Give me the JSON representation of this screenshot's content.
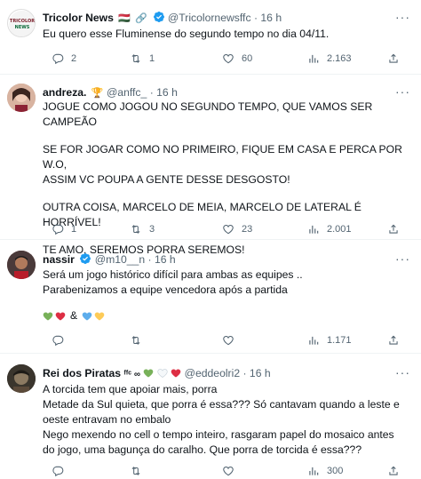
{
  "tweets": [
    {
      "name": "Tricolor News",
      "flag": "🇭🇺",
      "extra_icon": "🔗",
      "handle": "@Tricolornewsffc",
      "time": "· 16 h",
      "avatar_text": "TRICOLOR\nNEWS",
      "text": [
        "Eu quero esse Fluminense do segundo tempo no dia 04/11."
      ],
      "replies": "2",
      "retweets": "1",
      "likes": "60",
      "views": "2.163"
    },
    {
      "name": "andreza.",
      "badge": "🏆",
      "handle": "@anffc_",
      "time": "· 16 h",
      "text": [
        "JOGUE COMO JOGOU NO SEGUNDO TEMPO, QUE VAMOS SER CAMPEÃO",
        "SE FOR JOGAR COMO NO PRIMEIRO, FIQUE EM CASA E PERCA POR W.O,\nASSIM VC POUPA A GENTE DESSE DESGOSTO!",
        "OUTRA COISA, MARCELO DE MEIA, MARCELO DE LATERAL É HORRÍVEL!",
        "TE AMO, SEREMOS PORRA SEREMOS!"
      ],
      "replies": "1",
      "retweets": "3",
      "likes": "23",
      "views": "2.001"
    },
    {
      "name": "nassir",
      "handle": "@m10__n",
      "time": "· 16 h",
      "text": [
        "Será um jogo histórico difícil para ambas as equipes ..\nParabenizamos a equipe vencedora após a partida",
        "&"
      ],
      "replies": "",
      "retweets": "",
      "likes": "",
      "views": "1.171"
    },
    {
      "name": "Rei dos Piratas",
      "name_suffix": "ᶠᶠᶜ ∞",
      "handle": "@eddeolri2",
      "time": "· 16 h",
      "text": [
        "A torcida tem que apoiar mais, porra\nMetade da Sul quieta, que porra é essa??? Só cantavam quando a leste e\noeste entravam no embalo\nNego mexendo no cell o tempo inteiro, rasgaram papel do mosaico antes\ndo jogo, uma bagunça do caralho. Que porra de torcida é essa???"
      ],
      "replies": "",
      "retweets": "",
      "likes": "",
      "views": "300"
    }
  ],
  "colors": {
    "verified": "#1d9bf0",
    "muted": "#536471",
    "heart_green": "#78b159",
    "heart_red": "#dd2e44",
    "heart_blue": "#5dadec",
    "heart_yellow": "#fdcb58",
    "heart_white": "#f5f8fa"
  }
}
